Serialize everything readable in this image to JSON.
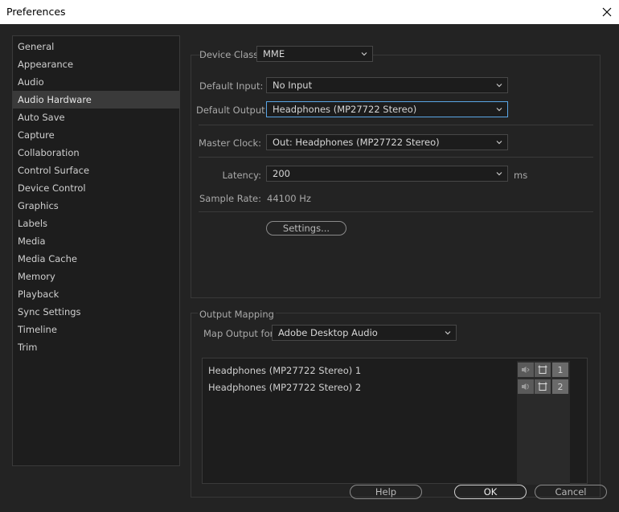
{
  "window": {
    "title": "Preferences"
  },
  "sidebar": {
    "items": [
      {
        "label": "General"
      },
      {
        "label": "Appearance"
      },
      {
        "label": "Audio"
      },
      {
        "label": "Audio Hardware"
      },
      {
        "label": "Auto Save"
      },
      {
        "label": "Capture"
      },
      {
        "label": "Collaboration"
      },
      {
        "label": "Control Surface"
      },
      {
        "label": "Device Control"
      },
      {
        "label": "Graphics"
      },
      {
        "label": "Labels"
      },
      {
        "label": "Media"
      },
      {
        "label": "Media Cache"
      },
      {
        "label": "Memory"
      },
      {
        "label": "Playback"
      },
      {
        "label": "Sync Settings"
      },
      {
        "label": "Timeline"
      },
      {
        "label": "Trim"
      }
    ],
    "selected": "Audio Hardware"
  },
  "device": {
    "class_label": "Device Class:",
    "class_value": "MME",
    "input_label": "Default Input:",
    "input_value": "No Input",
    "output_label": "Default Output:",
    "output_value": "Headphones (MP27722 Stereo)",
    "clock_label": "Master Clock:",
    "clock_value": "Out: Headphones (MP27722 Stereo)",
    "latency_label": "Latency:",
    "latency_value": "200",
    "latency_unit": "ms",
    "sample_rate_label": "Sample Rate:",
    "sample_rate_value": "44100 Hz",
    "settings_button": "Settings..."
  },
  "mapping": {
    "section_label": "Output Mapping",
    "map_for_label": "Map Output for:",
    "map_for_value": "Adobe Desktop Audio",
    "rows": [
      {
        "label": "Headphones (MP27722 Stereo) 1",
        "channel": "1"
      },
      {
        "label": "Headphones (MP27722 Stereo) 2",
        "channel": "2"
      }
    ]
  },
  "footer": {
    "help": "Help",
    "ok": "OK",
    "cancel": "Cancel"
  },
  "icons": {
    "close": "close-icon",
    "chevron": "chevron-down-icon",
    "speaker": "speaker-icon",
    "channel_frame": "channel-frame-icon"
  }
}
